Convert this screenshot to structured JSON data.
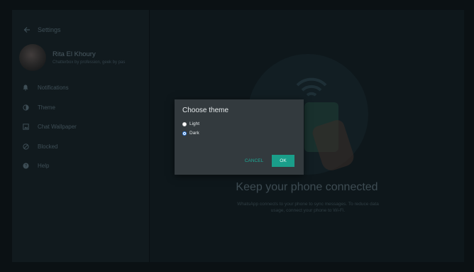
{
  "sidebar": {
    "header_title": "Settings",
    "profile": {
      "name": "Rita El Khoury",
      "about": "Chatterbox by profession, geek by pas"
    },
    "items": [
      {
        "label": "Notifications",
        "icon": "bell-icon"
      },
      {
        "label": "Theme",
        "icon": "theme-icon"
      },
      {
        "label": "Chat Wallpaper",
        "icon": "wallpaper-icon"
      },
      {
        "label": "Blocked",
        "icon": "blocked-icon"
      },
      {
        "label": "Help",
        "icon": "help-icon"
      }
    ]
  },
  "main": {
    "title": "Keep your phone connected",
    "description": "WhatsApp connects to your phone to sync messages. To reduce data usage, connect your phone to Wi-Fi."
  },
  "dialog": {
    "title": "Choose theme",
    "options": [
      {
        "label": "Light",
        "selected": false
      },
      {
        "label": "Dark",
        "selected": true
      }
    ],
    "cancel_label": "CANCEL",
    "ok_label": "OK"
  },
  "colors": {
    "accent": "#1a9e8a",
    "radio_selected": "#2f7de1",
    "dialog_bg": "#333a3e"
  }
}
